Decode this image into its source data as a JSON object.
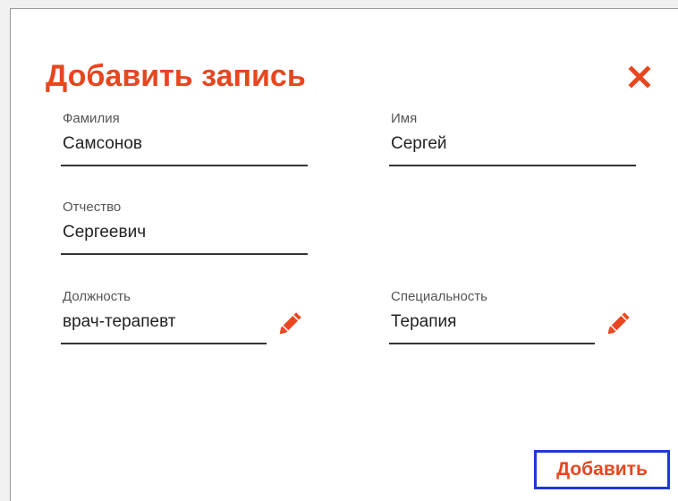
{
  "dialog": {
    "title": "Добавить запись",
    "close_icon": "close-icon",
    "accent_color": "#e8461f",
    "focus_color": "#1f3ad6"
  },
  "fields": {
    "last_name": {
      "label": "Фамилия",
      "value": "Самсонов"
    },
    "first_name": {
      "label": "Имя",
      "value": "Сергей"
    },
    "patronymic": {
      "label": "Отчество",
      "value": "Сергеевич"
    },
    "position": {
      "label": "Должность",
      "value": "врач-терапевт",
      "edit_icon": "pencil-icon"
    },
    "specialty": {
      "label": "Специальность",
      "value": "Терапия",
      "edit_icon": "pencil-icon"
    }
  },
  "actions": {
    "add_label": "Добавить"
  }
}
